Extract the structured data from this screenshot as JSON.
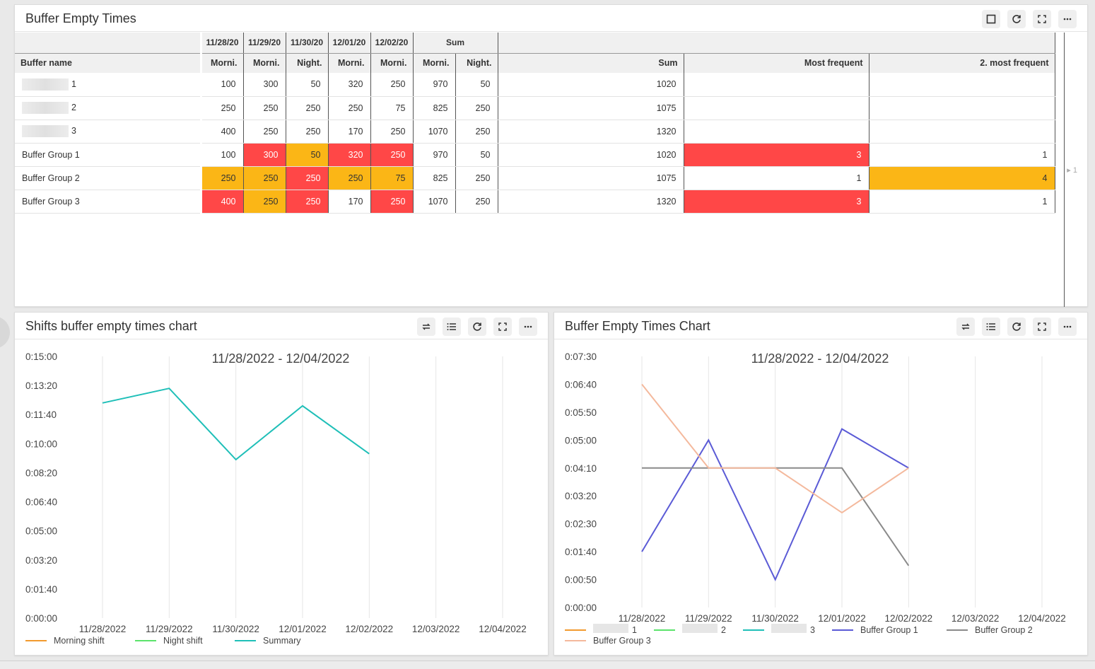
{
  "table_panel": {
    "title": "Buffer Empty Times",
    "date_headers": [
      "11/28/20",
      "11/29/20",
      "11/30/20",
      "12/01/20",
      "12/02/20"
    ],
    "sum_header": "Sum",
    "columns": [
      "Buffer name",
      "Morni.",
      "Morni.",
      "Night.",
      "Morni.",
      "Morni.",
      "Morni.",
      "Night.",
      "Sum",
      "Most frequent",
      "2. most frequent"
    ],
    "rows": [
      {
        "name": "1",
        "blurred": true,
        "cells": [
          "100",
          "300",
          "50",
          "320",
          "250",
          "970",
          "50",
          "1020",
          "",
          ""
        ],
        "colors": [
          "",
          "",
          "",
          "",
          "",
          "",
          "",
          "",
          "",
          ""
        ]
      },
      {
        "name": "2",
        "blurred": true,
        "cells": [
          "250",
          "250",
          "250",
          "250",
          "75",
          "825",
          "250",
          "1075",
          "",
          ""
        ],
        "colors": [
          "",
          "",
          "",
          "",
          "",
          "",
          "",
          "",
          "",
          ""
        ]
      },
      {
        "name": "3",
        "blurred": true,
        "cells": [
          "400",
          "250",
          "250",
          "170",
          "250",
          "1070",
          "250",
          "1320",
          "",
          ""
        ],
        "colors": [
          "",
          "",
          "",
          "",
          "",
          "",
          "",
          "",
          "",
          ""
        ]
      },
      {
        "name": "Buffer Group 1",
        "blurred": false,
        "cells": [
          "100",
          "300",
          "50",
          "320",
          "250",
          "970",
          "50",
          "1020",
          "3",
          "1"
        ],
        "colors": [
          "",
          "red",
          "yellow",
          "red",
          "red",
          "",
          "",
          "",
          "red",
          ""
        ]
      },
      {
        "name": "Buffer Group 2",
        "blurred": false,
        "cells": [
          "250",
          "250",
          "250",
          "250",
          "75",
          "825",
          "250",
          "1075",
          "1",
          "4"
        ],
        "colors": [
          "yellow",
          "yellow",
          "red",
          "yellow",
          "yellow",
          "",
          "",
          "",
          "",
          "yellow"
        ]
      },
      {
        "name": "Buffer Group 3",
        "blurred": false,
        "cells": [
          "400",
          "250",
          "250",
          "170",
          "250",
          "1070",
          "250",
          "1320",
          "3",
          "1"
        ],
        "colors": [
          "red",
          "yellow",
          "red",
          "",
          "red",
          "",
          "",
          "",
          "red",
          ""
        ]
      }
    ],
    "side_number": "1"
  },
  "colors": {
    "red": "#ff4747",
    "yellow": "#fbb616"
  },
  "left_chart_panel": {
    "title": "Shifts buffer empty times chart"
  },
  "right_chart_panel": {
    "title": "Buffer Empty Times Chart"
  },
  "chart_data": [
    {
      "type": "line",
      "title": "11/28/2022 - 12/04/2022",
      "categories": [
        "11/28/2022",
        "11/29/2022",
        "11/30/2022",
        "12/01/2022",
        "12/02/2022",
        "12/03/2022",
        "12/04/2022"
      ],
      "y_tick_labels": [
        "0:00:00",
        "0:01:40",
        "0:03:20",
        "0:05:00",
        "0:06:40",
        "0:08:20",
        "0:10:00",
        "0:11:40",
        "0:13:20",
        "0:15:00"
      ],
      "ylim_seconds": [
        0,
        900
      ],
      "legend_position": "bottom-left",
      "series": [
        {
          "name": "Morning shift",
          "color": "#f29a2e",
          "values_seconds": [
            null,
            null,
            null,
            null,
            null,
            null,
            null
          ]
        },
        {
          "name": "Night shift",
          "color": "#5be36b",
          "values_seconds": [
            null,
            null,
            null,
            null,
            null,
            null,
            null
          ]
        },
        {
          "name": "Summary",
          "color": "#1fbfb8",
          "values_seconds": [
            740,
            790,
            545,
            730,
            565,
            null,
            null
          ]
        }
      ]
    },
    {
      "type": "line",
      "title": "11/28/2022 - 12/04/2022",
      "categories": [
        "11/28/2022",
        "11/29/2022",
        "11/30/2022",
        "12/01/2022",
        "12/02/2022",
        "12/03/2022",
        "12/04/2022"
      ],
      "y_tick_labels": [
        "0:00:00",
        "0:00:50",
        "0:01:40",
        "0:02:30",
        "0:03:20",
        "0:04:10",
        "0:05:00",
        "0:05:50",
        "0:06:40",
        "0:07:30"
      ],
      "ylim_seconds": [
        0,
        450
      ],
      "legend_position": "bottom-left",
      "series": [
        {
          "name": "1",
          "blurred": true,
          "color": "#f29a2e",
          "values_seconds": [
            null,
            null,
            null,
            null,
            null,
            null,
            null
          ]
        },
        {
          "name": "2",
          "blurred": true,
          "color": "#5be36b",
          "values_seconds": [
            null,
            null,
            null,
            null,
            null,
            null,
            null
          ]
        },
        {
          "name": "3",
          "blurred": true,
          "color": "#1fbfb8",
          "values_seconds": [
            null,
            null,
            null,
            null,
            null,
            null,
            null
          ]
        },
        {
          "name": "Buffer Group 1",
          "color": "#5b5bd6",
          "values_seconds": [
            100,
            300,
            50,
            320,
            250,
            null,
            null
          ]
        },
        {
          "name": "Buffer Group 2",
          "color": "#8a8a8a",
          "values_seconds": [
            250,
            250,
            250,
            250,
            75,
            null,
            null
          ]
        },
        {
          "name": "Buffer Group 3",
          "color": "#f4b99d",
          "values_seconds": [
            400,
            250,
            250,
            170,
            250,
            null,
            null
          ]
        }
      ]
    }
  ]
}
